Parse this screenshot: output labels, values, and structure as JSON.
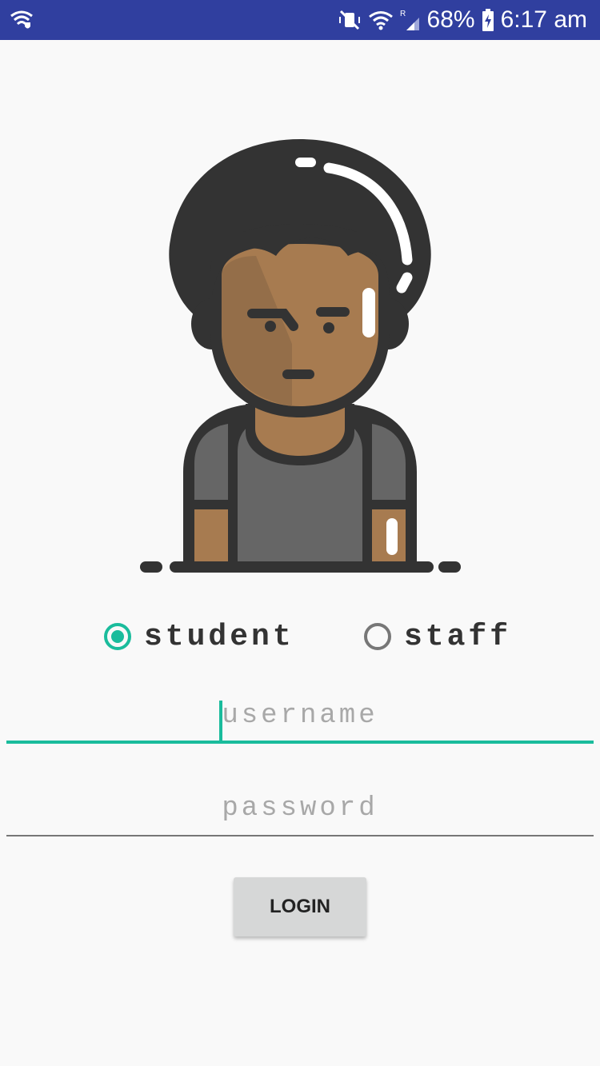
{
  "status_bar": {
    "battery": "68%",
    "time": "6:17 am"
  },
  "role_selector": {
    "options": [
      {
        "label": "student",
        "selected": true
      },
      {
        "label": "staff",
        "selected": false
      }
    ]
  },
  "form": {
    "username": {
      "value": "",
      "placeholder": "username"
    },
    "password": {
      "value": "",
      "placeholder": "password"
    },
    "login_label": "LOGIN"
  },
  "colors": {
    "status_bar": "#303f9f",
    "accent": "#1abc9c",
    "background": "#f9f9f9",
    "button": "#d6d7d7"
  }
}
